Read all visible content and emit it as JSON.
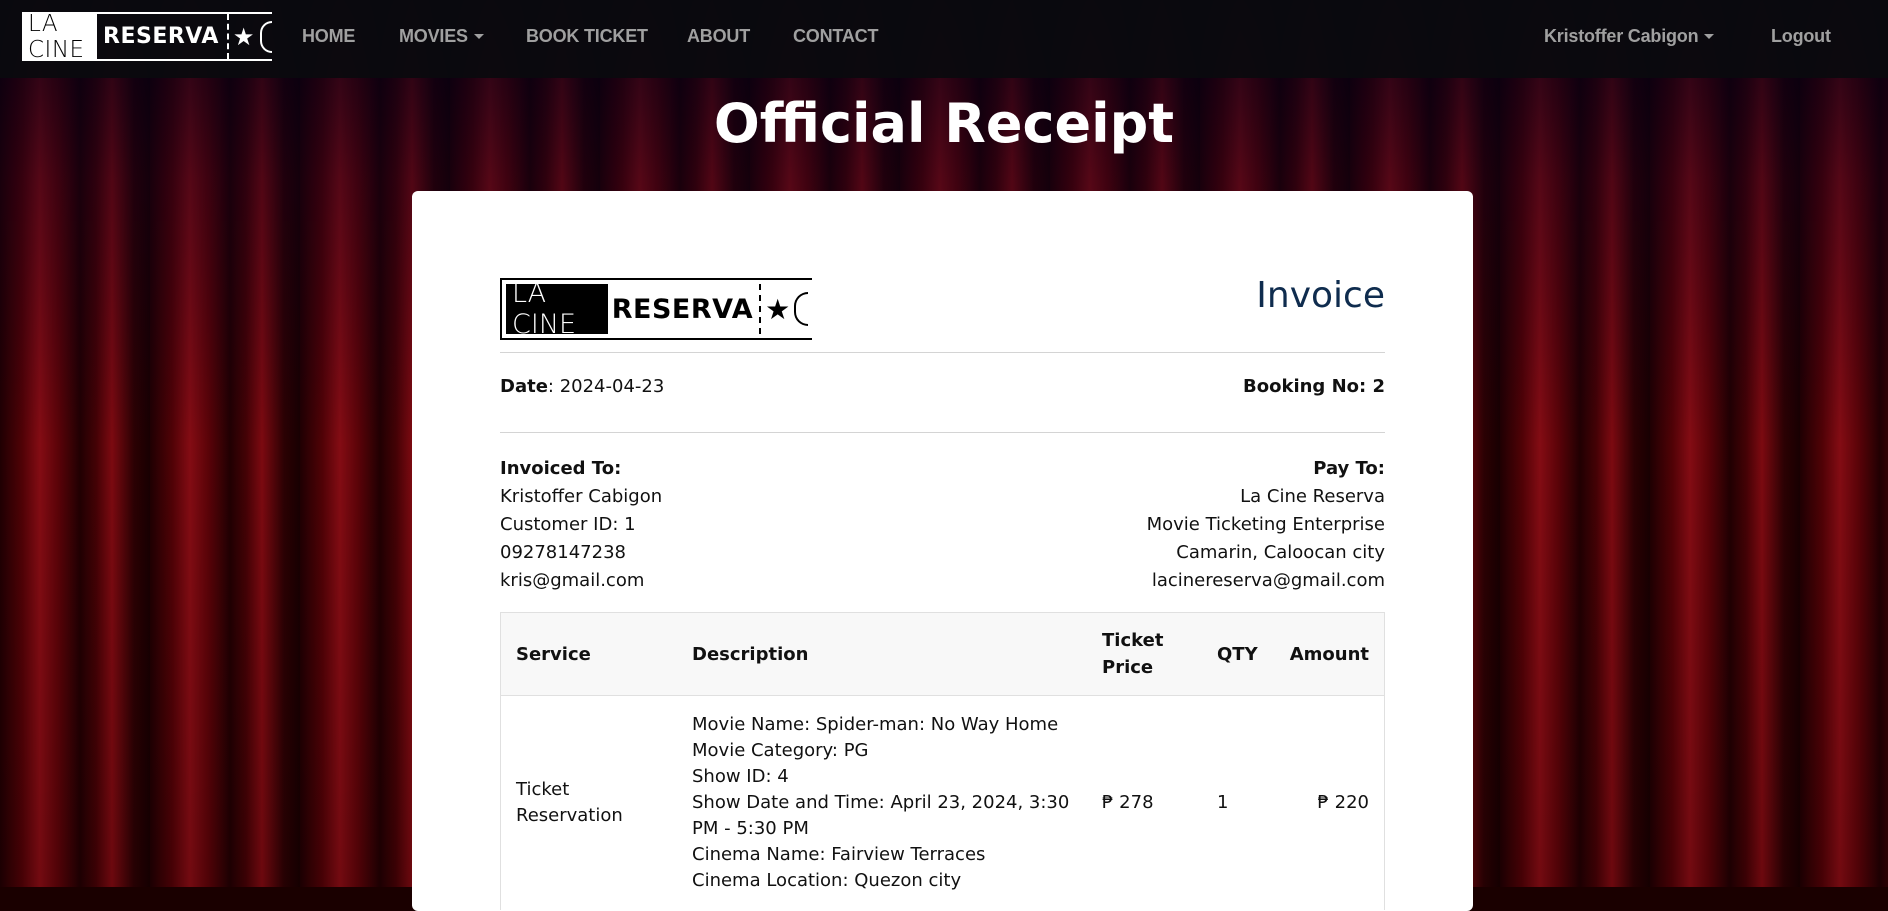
{
  "navbar": {
    "logo": {
      "part1": "LA CINE",
      "part2": "RESERVA",
      "star": "★"
    },
    "links": [
      "HOME",
      "MOVIES",
      "BOOK TICKET",
      "ABOUT",
      "CONTACT"
    ],
    "user_name": "Kristoffer Cabigon",
    "logout": "Logout"
  },
  "page": {
    "title": "Official Receipt"
  },
  "invoice": {
    "logo": {
      "part1": "LA CINE",
      "part2": "RESERVA",
      "star": "★"
    },
    "heading": "Invoice",
    "date_label": "Date",
    "date_value": ": 2024-04-23",
    "booking_label": "Booking No: 2",
    "invoiced_to": {
      "label": "Invoiced To:",
      "name": "Kristoffer Cabigon",
      "customer_id": "Customer ID: 1",
      "phone": "09278147238",
      "email": "kris@gmail.com"
    },
    "pay_to": {
      "label": "Pay To:",
      "name": "La Cine Reserva",
      "business": "Movie Ticketing Enterprise",
      "address": "Camarin, Caloocan city",
      "email": "lacinereserva@gmail.com"
    },
    "table": {
      "headers": [
        "Service",
        "Description",
        "Ticket Price",
        "QTY",
        "Amount"
      ],
      "rows": [
        {
          "service": "Ticket Reservation",
          "description": [
            "Movie Name: Spider-man: No Way Home",
            "Movie Category: PG",
            "Show ID: 4",
            "Show Date and Time: April 23, 2024, 3:30 PM - 5:30 PM",
            "Cinema Name: Fairview Terraces",
            "Cinema Location: Quezon city"
          ],
          "ticket_price": "₱ 278",
          "qty": "1",
          "amount": "₱ 220"
        }
      ]
    }
  }
}
